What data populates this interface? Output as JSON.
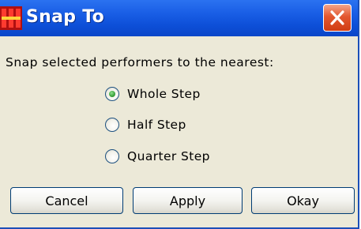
{
  "window": {
    "title": "Snap To",
    "close_icon": "close-x-icon",
    "logo_icon": "app-logo-icon",
    "colors": {
      "titlebar": "#0d4fd8",
      "close_button": "#d84a21",
      "dialog_background": "#ece9d8",
      "radio_selected_dot": "#3aa13a"
    }
  },
  "prompt": "Snap selected performers to the nearest:",
  "options": [
    {
      "label": "Whole Step",
      "selected": true
    },
    {
      "label": "Half Step",
      "selected": false
    },
    {
      "label": "Quarter Step",
      "selected": false
    }
  ],
  "buttons": {
    "cancel": "Cancel",
    "apply": "Apply",
    "okay": "Okay"
  }
}
